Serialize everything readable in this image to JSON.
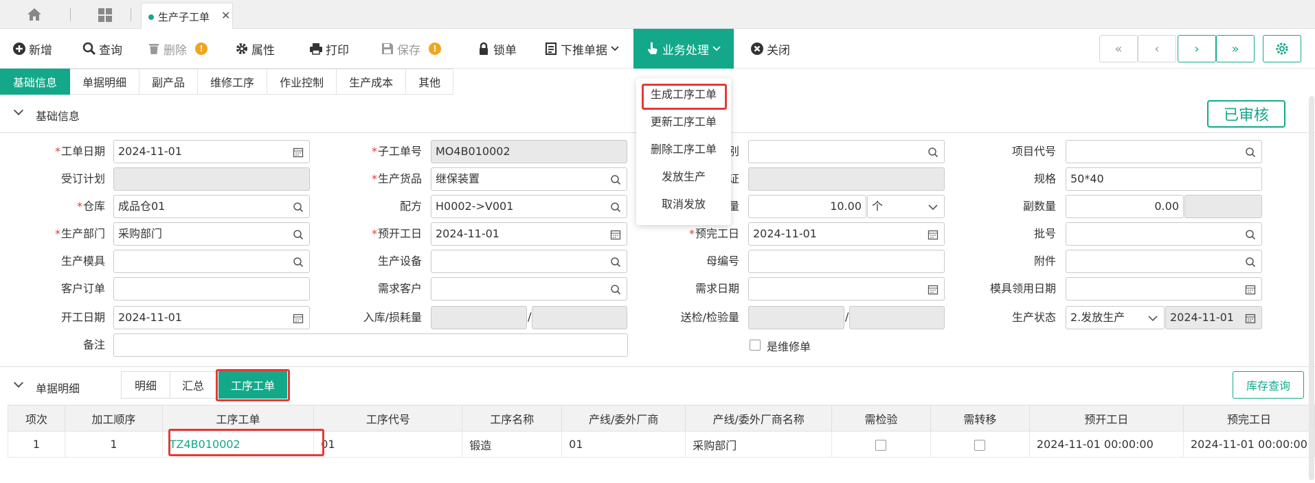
{
  "top_tabs": {
    "active_doc": "生产子工单"
  },
  "toolbar": {
    "new": "新增",
    "query": "查询",
    "delete": "删除",
    "properties": "属性",
    "print": "打印",
    "save": "保存",
    "lock": "锁单",
    "push_down": "下推单据",
    "business": "业务处理",
    "close": "关闭"
  },
  "business_menu": [
    "生成工序工单",
    "更新工序工单",
    "删除工序工单",
    "发放生产",
    "取消发放"
  ],
  "section_tabs": [
    "基础信息",
    "单据明细",
    "副产品",
    "维修工序",
    "作业控制",
    "生产成本",
    "其他"
  ],
  "basic": {
    "title": "基础信息",
    "status_stamp": "已审核"
  },
  "form": {
    "work_date_label": "工单日期",
    "work_date": "2024-11-01",
    "sub_order_no_label": "子工单号",
    "sub_order_no": "MO4B010002",
    "category_label_partial": "别",
    "project_code_label": "项目代号",
    "order_plan_label": "受订计划",
    "product_label": "生产货品",
    "product": "继保装置",
    "cert_label_partial": "证",
    "spec_label": "规格",
    "spec": "50*40",
    "warehouse_label": "仓库",
    "warehouse": "成品仓01",
    "recipe_label": "配方",
    "recipe": "H0002->V001",
    "qty_label_partial": "量",
    "qty": "10.00",
    "unit": "个",
    "sub_qty_label": "副数量",
    "sub_qty": "0.00",
    "dept_label": "生产部门",
    "dept": "采购部门",
    "plan_start_label": "预开工日",
    "plan_start": "2024-11-01",
    "plan_end_label": "预完工日",
    "plan_end": "2024-11-01",
    "batch_label": "批号",
    "mold_label": "生产模具",
    "equipment_label": "生产设备",
    "parent_no_label": "母编号",
    "attachment_label": "附件",
    "customer_order_label": "客户订单",
    "demand_customer_label": "需求客户",
    "demand_date_label": "需求日期",
    "mold_date_label": "模具领用日期",
    "start_date_label": "开工日期",
    "start_date": "2024-11-01",
    "in_loss_label": "入库/损耗量",
    "inspect_label": "送检/检验量",
    "prod_status_label": "生产状态",
    "prod_status": "2.发放生产",
    "status_date": "2024-11-01",
    "remark_label": "备注",
    "is_repair_label": "是维修单"
  },
  "detail": {
    "title": "单据明细",
    "tabs": [
      "明细",
      "汇总",
      "工序工单"
    ],
    "stock_query": "库存查询",
    "columns": [
      "项次",
      "加工顺序",
      "工序工单",
      "工序代号",
      "工序名称",
      "产线/委外厂商",
      "产线/委外厂商名称",
      "需检验",
      "需转移",
      "预开工日",
      "预完工日"
    ],
    "rows": [
      {
        "seq": "1",
        "order": "1",
        "op_order": "TZ4B010002",
        "op_code": "01",
        "op_name": "锻造",
        "line": "01",
        "line_name": "采购部门",
        "start": "2024-11-01 00:00:00",
        "end": "2024-11-01 00:00:00"
      }
    ]
  },
  "colors": {
    "accent": "#13a889",
    "highlight": "#e53935",
    "warning": "#f2a51a"
  }
}
